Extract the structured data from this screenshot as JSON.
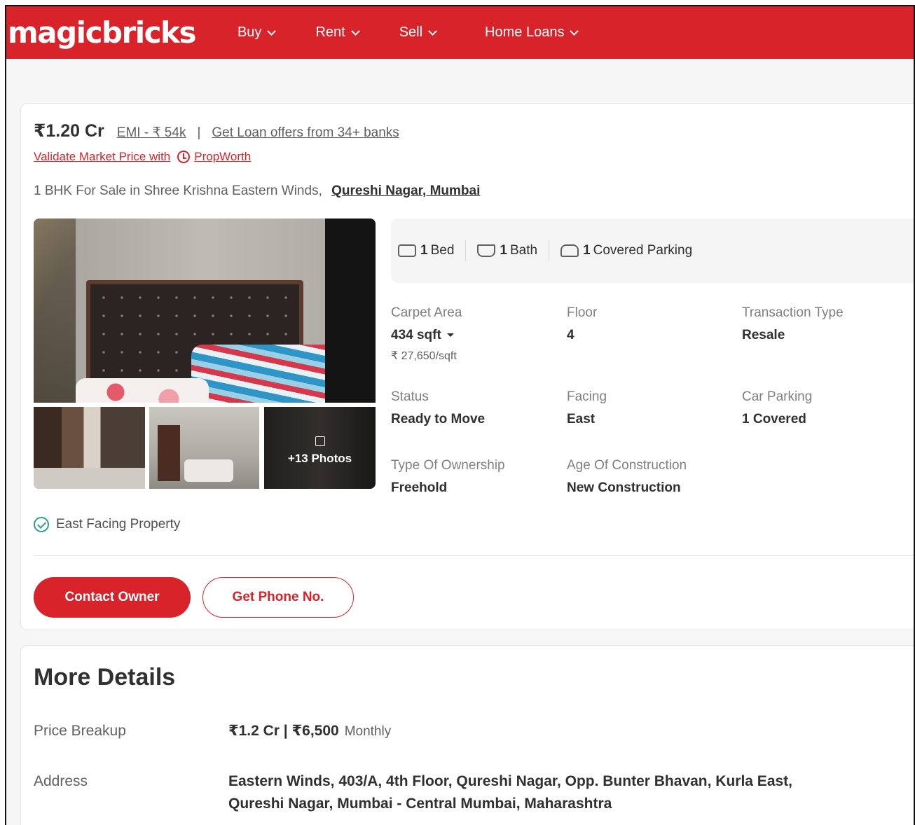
{
  "header": {
    "logo": "magicbricks",
    "nav": [
      {
        "label": "Buy"
      },
      {
        "label": "Rent"
      },
      {
        "label": "Sell"
      },
      {
        "label": "Home Loans"
      }
    ],
    "brand_color": "#d8232a"
  },
  "listing": {
    "price": "₹1.20 Cr",
    "emi": "EMI - ₹ 54k",
    "separator": "|",
    "loan_offer": "Get Loan offers from 34+ banks",
    "validate_text": "Validate Market Price with",
    "propworth": "PropWorth",
    "title": "1 BHK For Sale in Shree Krishna Eastern Winds,",
    "locality": "Qureshi Nagar, Mumbai",
    "photos_more": "+13 Photos",
    "amenities": {
      "bed_count": "1",
      "bed_label": "Bed",
      "bath_count": "1",
      "bath_label": "Bath",
      "parking_count": "1",
      "parking_label": "Covered Parking"
    },
    "summary": {
      "carpet_area_label": "Carpet Area",
      "carpet_area_value": "434 sqft",
      "price_per_sqft": "₹ 27,650/sqft",
      "floor_label": "Floor",
      "floor_value": "4",
      "transaction_label": "Transaction Type",
      "transaction_value": "Resale",
      "status_label": "Status",
      "status_value": "Ready to Move",
      "facing_label": "Facing",
      "facing_value": "East",
      "car_parking_label": "Car Parking",
      "car_parking_value": "1 Covered",
      "ownership_label": "Type Of Ownership",
      "ownership_value": "Freehold",
      "age_label": "Age Of Construction",
      "age_value": "New Construction"
    },
    "highlight": "East Facing Property",
    "contact_button": "Contact Owner",
    "phone_button": "Get Phone No."
  },
  "more_details": {
    "title": "More Details",
    "price_breakup_label": "Price Breakup",
    "price_breakup_value": "₹1.2 Cr | ₹6,500",
    "price_breakup_suffix": "Monthly",
    "address_label": "Address",
    "address_line1": "Eastern Winds, 403/A, 4th Floor, Qureshi Nagar, Opp. Bunter Bhavan, Kurla East,",
    "address_line2": "Qureshi Nagar, Mumbai - Central Mumbai, Maharashtra"
  }
}
